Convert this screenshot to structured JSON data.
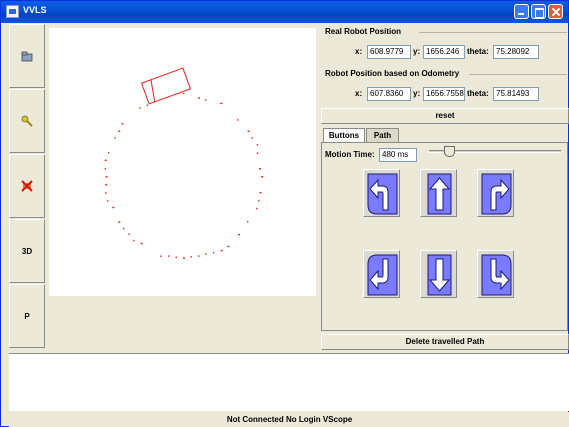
{
  "window": {
    "title": "VVLS"
  },
  "toolbar": {
    "items": [
      {
        "name": "open-tool",
        "label": ""
      },
      {
        "name": "key-tool",
        "label": ""
      },
      {
        "name": "disconnect-tool",
        "label": ""
      },
      {
        "name": "3d-tool",
        "label": "3D"
      },
      {
        "name": "p-tool",
        "label": "P"
      }
    ]
  },
  "real_position": {
    "title": "Real Robot Position",
    "x_label": "x:",
    "x_value": "608.9779",
    "y_label": "y:",
    "y_value": "1656.246",
    "theta_label": "theta:",
    "theta_value": "75.28092"
  },
  "odometry_position": {
    "title": "Robot Position based on Odometry",
    "x_label": "x:",
    "x_value": "607.8360",
    "y_label": "y:",
    "y_value": "1656.7558",
    "theta_label": "theta:",
    "theta_value": "75.81493"
  },
  "reset_label": "reset",
  "tabs": [
    {
      "label": "Buttons"
    },
    {
      "label": "Path"
    }
  ],
  "motion": {
    "label": "Motion Time:",
    "value": "480 ms"
  },
  "slider_fraction": 0.15,
  "arrow_buttons": [
    {
      "name": "turn-left-button",
      "icon": "turn-left-arrow-icon"
    },
    {
      "name": "forward-button",
      "icon": "up-arrow-icon"
    },
    {
      "name": "turn-right-button",
      "icon": "turn-right-arrow-icon"
    },
    {
      "name": "back-left-button",
      "icon": "back-left-arrow-icon"
    },
    {
      "name": "backward-button",
      "icon": "down-arrow-icon"
    },
    {
      "name": "back-right-button",
      "icon": "back-right-arrow-icon"
    }
  ],
  "delete_path_label": "Delete travelled Path",
  "status": "Not Connected No Login VScope",
  "colors": {
    "path": "#e02020",
    "arrow_fill": "#7b7bff",
    "arrow_outline": "#1a1a7a",
    "title_bar": "#0650d3"
  }
}
